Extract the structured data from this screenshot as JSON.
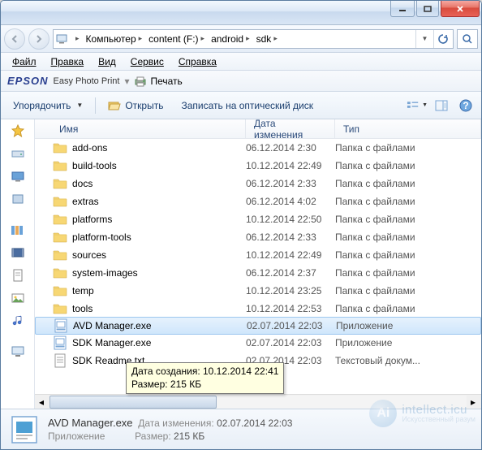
{
  "breadcrumb": [
    {
      "label": "Компьютер"
    },
    {
      "label": "content (F:)"
    },
    {
      "label": "android"
    },
    {
      "label": "sdk"
    }
  ],
  "menu": {
    "file": "Файл",
    "edit": "Правка",
    "view": "Вид",
    "tools": "Сервис",
    "help": "Справка"
  },
  "epson": {
    "logo": "EPSON",
    "sub": "Easy Photo Print",
    "print": "Печать"
  },
  "toolbar": {
    "organize": "Упорядочить",
    "open": "Открыть",
    "burn": "Записать на оптический диск"
  },
  "columns": {
    "name": "Имя",
    "date": "Дата изменения",
    "type": "Тип"
  },
  "files": [
    {
      "icon": "folder",
      "name": "add-ons",
      "date": "06.12.2014 2:30",
      "type": "Папка с файлами"
    },
    {
      "icon": "folder",
      "name": "build-tools",
      "date": "10.12.2014 22:49",
      "type": "Папка с файлами"
    },
    {
      "icon": "folder",
      "name": "docs",
      "date": "06.12.2014 2:33",
      "type": "Папка с файлами"
    },
    {
      "icon": "folder",
      "name": "extras",
      "date": "06.12.2014 4:02",
      "type": "Папка с файлами"
    },
    {
      "icon": "folder",
      "name": "platforms",
      "date": "10.12.2014 22:50",
      "type": "Папка с файлами"
    },
    {
      "icon": "folder",
      "name": "platform-tools",
      "date": "06.12.2014 2:33",
      "type": "Папка с файлами"
    },
    {
      "icon": "folder",
      "name": "sources",
      "date": "10.12.2014 22:49",
      "type": "Папка с файлами"
    },
    {
      "icon": "folder",
      "name": "system-images",
      "date": "06.12.2014 2:37",
      "type": "Папка с файлами"
    },
    {
      "icon": "folder",
      "name": "temp",
      "date": "10.12.2014 23:25",
      "type": "Папка с файлами"
    },
    {
      "icon": "folder",
      "name": "tools",
      "date": "10.12.2014 22:53",
      "type": "Папка с файлами"
    },
    {
      "icon": "exe",
      "name": "AVD Manager.exe",
      "date": "02.07.2014 22:03",
      "type": "Приложение",
      "selected": true
    },
    {
      "icon": "exe",
      "name": "SDK Manager.exe",
      "date": "02.07.2014 22:03",
      "type": "Приложение"
    },
    {
      "icon": "txt",
      "name": "SDK Readme.txt",
      "date": "02.07.2014 22:03",
      "type": "Текстовый докум..."
    }
  ],
  "tooltip": {
    "line1": "Дата создания: 10.12.2014 22:41",
    "line2": "Размер: 215 КБ"
  },
  "status": {
    "name": "AVD Manager.exe",
    "date_label": "Дата изменения:",
    "date": "02.07.2014 22:03",
    "type_label": "Приложение",
    "size_label": "Размер:",
    "size": "215 КБ"
  },
  "watermark": {
    "t1": "intellect.icu",
    "t2": "Искусственный разум"
  }
}
